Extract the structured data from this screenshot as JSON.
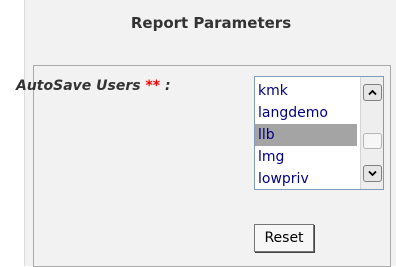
{
  "header": {
    "title": "Report Parameters"
  },
  "field": {
    "label": "AutoSave Users",
    "required_marker": "**",
    "label_suffix": " :"
  },
  "listbox": {
    "items": [
      "kmk",
      "langdemo",
      "llb",
      "lmg",
      "lowpriv"
    ],
    "selected": "llb"
  },
  "buttons": {
    "reset_label": "Reset"
  },
  "icons": {
    "scroll_up": "chevron-up-icon",
    "scroll_down": "chevron-down-icon"
  },
  "colors": {
    "required": "#ff0000",
    "list_text": "#000080",
    "selection": "#a4a4a4"
  }
}
